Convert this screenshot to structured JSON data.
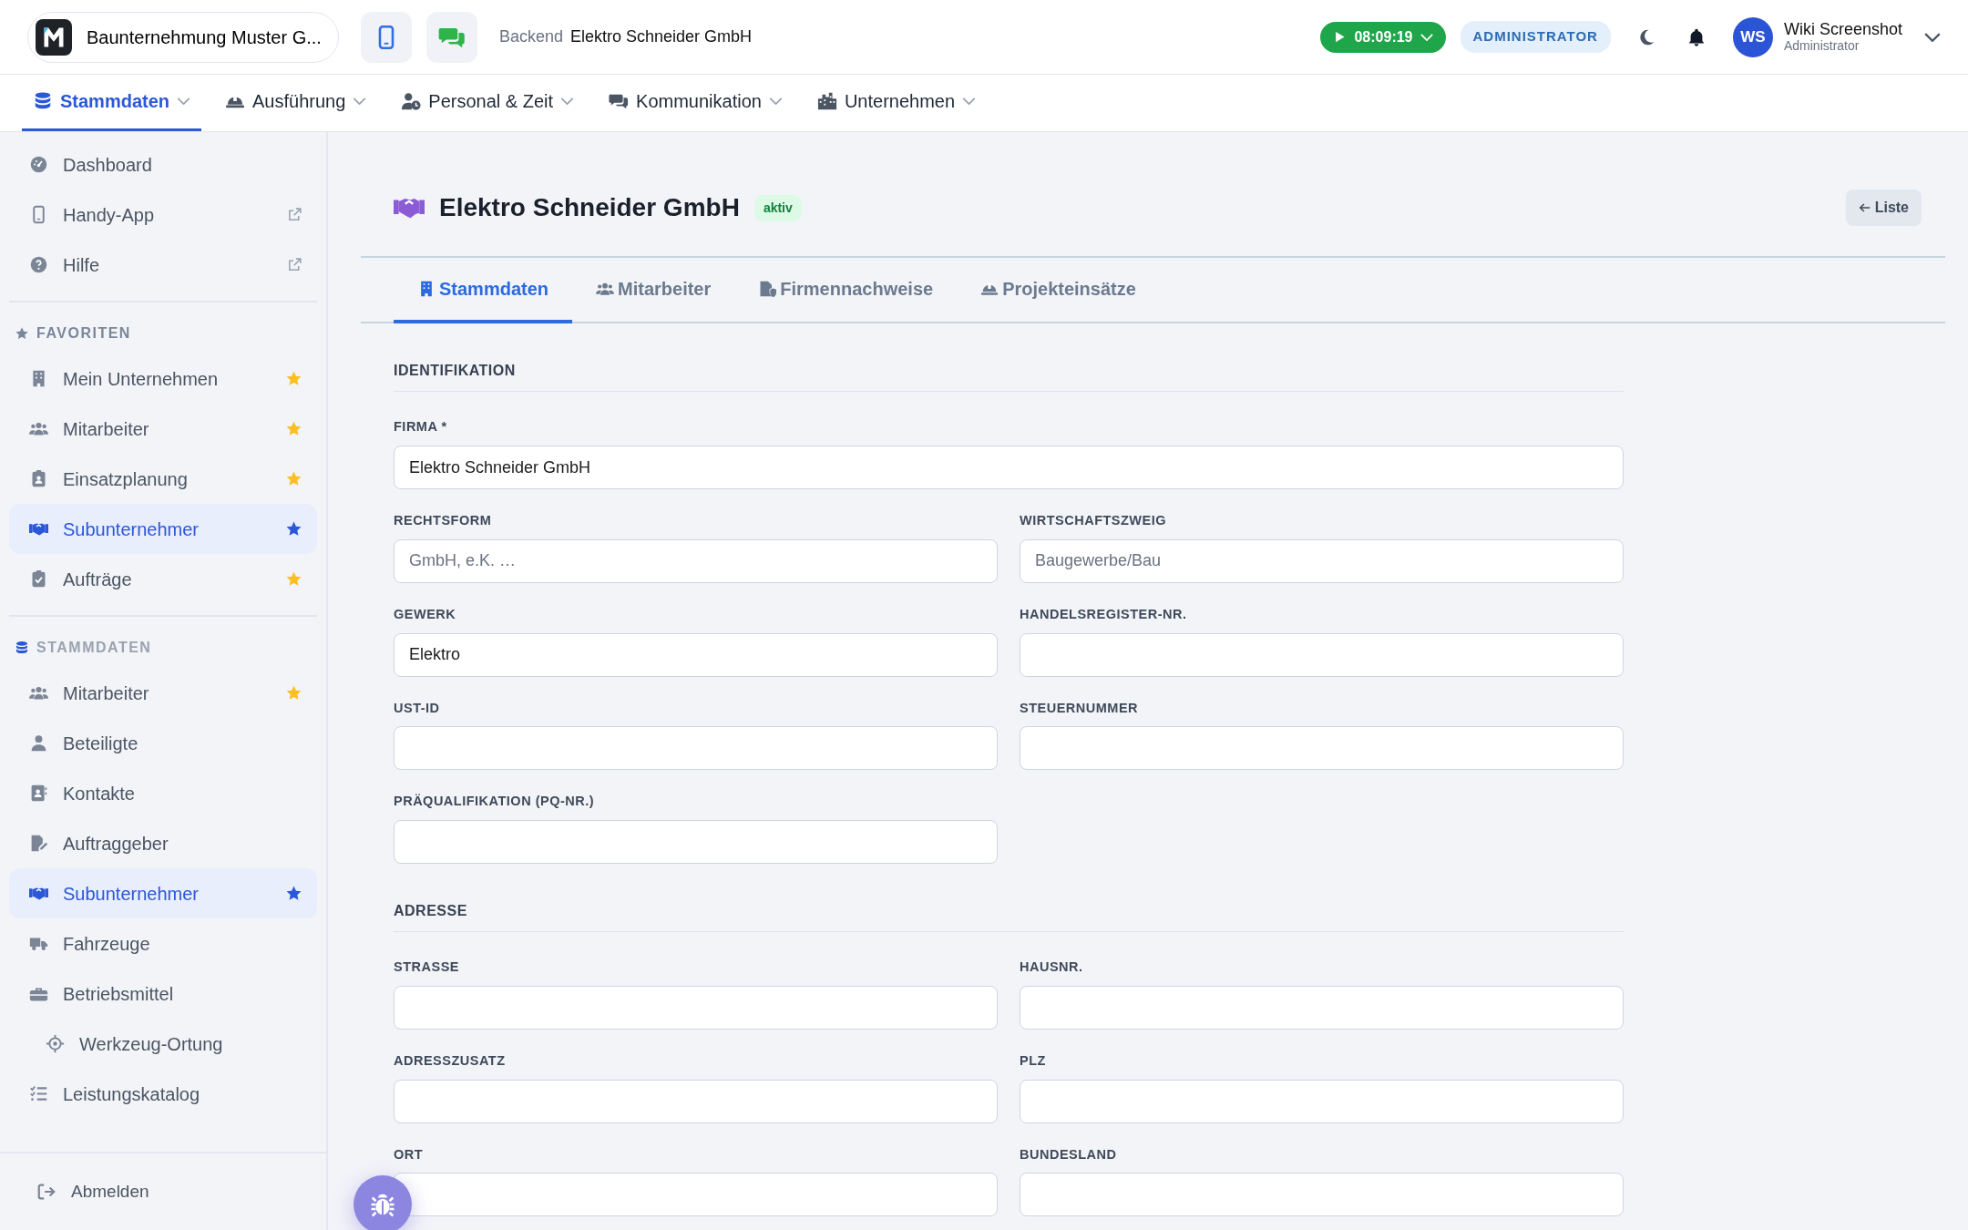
{
  "topbar": {
    "company": "Baunternehmung Muster G...",
    "breadcrumb_label": "Backend",
    "breadcrumb_value": "Elektro Schneider GmbH",
    "timer": "08:09:19",
    "role_badge": "ADMINISTRATOR",
    "user": {
      "initials": "WS",
      "name": "Wiki Screenshot",
      "role": "Administrator"
    }
  },
  "main_nav": [
    {
      "label": "Stammdaten",
      "selected": true
    },
    {
      "label": "Ausführung",
      "selected": false
    },
    {
      "label": "Personal & Zeit",
      "selected": false
    },
    {
      "label": "Kommunikation",
      "selected": false
    },
    {
      "label": "Unternehmen",
      "selected": false
    }
  ],
  "sidebar": {
    "top_items": [
      {
        "label": "Dashboard",
        "external": false
      },
      {
        "label": "Handy-App",
        "external": true
      },
      {
        "label": "Hilfe",
        "external": true
      }
    ],
    "sections": [
      {
        "kind": "favorites",
        "title": "FAVORITEN",
        "items": [
          {
            "label": "Mein Unternehmen",
            "favorite": true,
            "selected": false
          },
          {
            "label": "Mitarbeiter",
            "favorite": true,
            "selected": false
          },
          {
            "label": "Einsatzplanung",
            "favorite": true,
            "selected": false
          },
          {
            "label": "Subunternehmer",
            "favorite": true,
            "selected": true
          },
          {
            "label": "Aufträge",
            "favorite": true,
            "selected": false
          }
        ]
      },
      {
        "kind": "category",
        "title": "STAMMDATEN",
        "items": [
          {
            "label": "Mitarbeiter",
            "favorite": true,
            "selected": false
          },
          {
            "label": "Beteiligte",
            "favorite": false,
            "selected": false
          },
          {
            "label": "Kontakte",
            "favorite": false,
            "selected": false
          },
          {
            "label": "Auftraggeber",
            "favorite": false,
            "selected": false
          },
          {
            "label": "Subunternehmer",
            "favorite": true,
            "selected": true
          },
          {
            "label": "Fahrzeuge",
            "favorite": false,
            "selected": false
          },
          {
            "label": "Betriebsmittel",
            "favorite": false,
            "selected": false,
            "children": [
              {
                "label": "Werkzeug-Ortung",
                "favorite": false,
                "selected": false
              }
            ]
          },
          {
            "label": "Leistungskatalog",
            "favorite": false,
            "selected": false
          }
        ]
      }
    ],
    "logout": "Abmelden"
  },
  "page": {
    "title": "Elektro Schneider GmbH",
    "status": "aktiv",
    "back_button": "Liste",
    "tabs": [
      {
        "label": "Stammdaten",
        "selected": true
      },
      {
        "label": "Mitarbeiter",
        "selected": false
      },
      {
        "label": "Firmennachweise",
        "selected": false
      },
      {
        "label": "Projekteinsätze",
        "selected": false
      }
    ],
    "form_sections": [
      {
        "title": "IDENTIFIKATION",
        "fields": [
          {
            "label": "FIRMA *",
            "value": "Elektro Schneider GmbH",
            "kind": "wide"
          },
          {
            "label": "RECHTSFORM",
            "placeholder": "GmbH, e.K. …",
            "kind": "half"
          },
          {
            "label": "WIRTSCHAFTSZWEIG",
            "placeholder": "Baugewerbe/Bau",
            "kind": "half"
          },
          {
            "label": "GEWERK",
            "value": "Elektro",
            "kind": "half"
          },
          {
            "label": "HANDELSREGISTER-NR.",
            "kind": "half"
          },
          {
            "label": "UST-ID",
            "kind": "half"
          },
          {
            "label": "STEUERNUMMER",
            "kind": "half"
          },
          {
            "label": "PRÄQUALIFIKATION (PQ-NR.)",
            "kind": "half"
          }
        ]
      },
      {
        "title": "ADRESSE",
        "fields": [
          {
            "label": "STRASSE",
            "kind": "half"
          },
          {
            "label": "HAUSNR.",
            "kind": "half"
          },
          {
            "label": "ADRESSZUSATZ",
            "kind": "half"
          },
          {
            "label": "PLZ",
            "kind": "half"
          },
          {
            "label": "ORT",
            "kind": "half"
          },
          {
            "label": "BUNDESLAND",
            "kind": "half"
          }
        ]
      }
    ]
  }
}
